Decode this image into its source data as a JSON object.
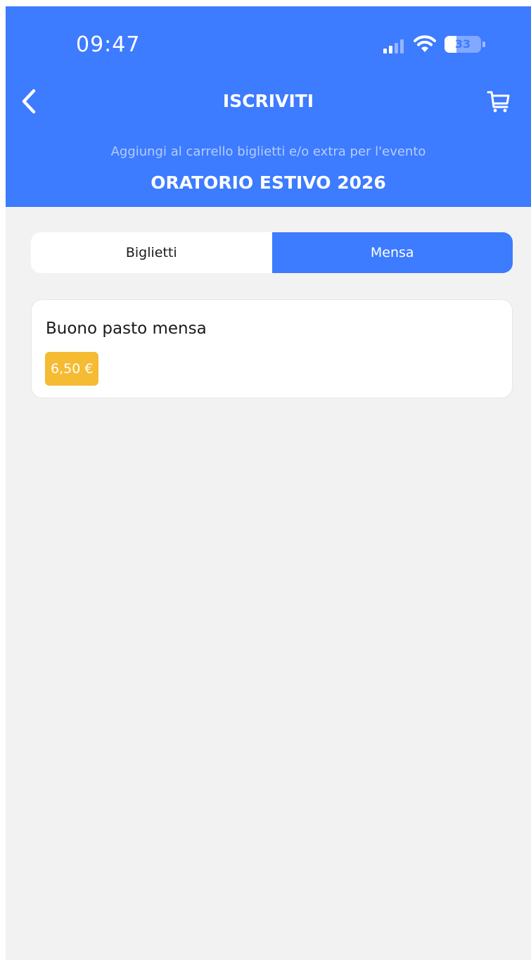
{
  "status_bar": {
    "time": "09:47",
    "battery": "33",
    "battery_level": 0.33
  },
  "nav": {
    "title": "ISCRIVITI"
  },
  "header": {
    "subtitle": "Aggiungi al carrello biglietti e/o extra per l'evento",
    "event_title": "ORATORIO ESTIVO 2026"
  },
  "tabs": [
    {
      "label": "Biglietti",
      "active": false
    },
    {
      "label": "Mensa",
      "active": true
    }
  ],
  "items": [
    {
      "title": "Buono pasto mensa",
      "price": "6,50 €"
    }
  ],
  "colors": {
    "primary": "#3d7bff",
    "background": "#f2f2f2",
    "price_badge": "#f5bb33"
  },
  "icons": {
    "back": "chevron-left-icon",
    "cart": "cart-icon",
    "signal": "signal-icon",
    "wifi": "wifi-icon",
    "battery": "battery-icon"
  }
}
